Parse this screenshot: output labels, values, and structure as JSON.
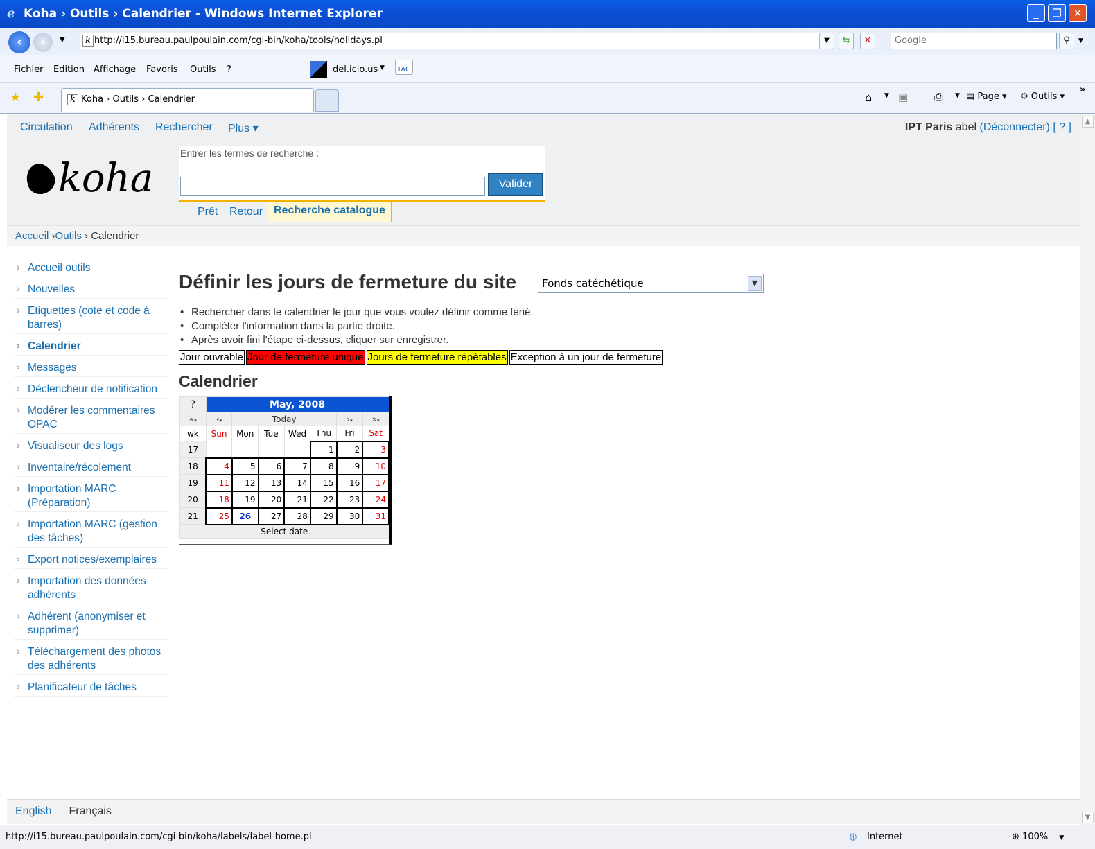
{
  "window": {
    "title": "Koha › Outils › Calendrier - Windows Internet Explorer",
    "ie_icon": "ie-logo",
    "controls": [
      "_",
      "❐",
      "✕"
    ]
  },
  "address": {
    "url": "http://i15.bureau.paulpoulain.com/cgi-bin/koha/tools/holidays.pl",
    "favicon": "k",
    "search_placeholder": "Google"
  },
  "menu": {
    "items": [
      "Fichier",
      "Edition",
      "Affichage",
      "Favoris",
      "Outils",
      "?"
    ],
    "delicious": "del.icio.us",
    "tag": "TAG"
  },
  "favbar": {
    "tab_title": "Koha › Outils › Calendrier",
    "page": "Page",
    "tools": "Outils"
  },
  "topnav": {
    "links": [
      "Circulation",
      "Adhérents",
      "Rechercher",
      "Plus ▾"
    ],
    "branch": "IPT Paris",
    "user": "abel",
    "logout": "(Déconnecter)",
    "help": "[ ? ]"
  },
  "logo": "koha",
  "search": {
    "label": "Entrer les termes de recherche :",
    "value": "",
    "button": "Valider",
    "tabs": [
      "Prêt",
      "Retour",
      "Recherche catalogue"
    ]
  },
  "breadcrumb": {
    "home": "Accueil",
    "sep1": " ›",
    "tools": "Outils",
    "sep2": " › ",
    "current": "Calendrier"
  },
  "sidebar": {
    "items": [
      "Accueil outils",
      "Nouvelles",
      "Etiquettes (cote et code à barres)",
      "Calendrier",
      "Messages",
      "Déclencheur de notification",
      "Modérer les commentaires OPAC",
      "Visualiseur des logs",
      "Inventaire/récolement",
      "Importation MARC (Préparation)",
      "Importation MARC (gestion des tâches)",
      "Export notices/exemplaires",
      "Importation des données adhérents",
      "Adhérent (anonymiser et supprimer)",
      "Téléchargement des photos des adhérents",
      "Planificateur de tâches"
    ],
    "current_index": 3
  },
  "main": {
    "title": "Définir les jours de fermeture du site",
    "branch_select": "Fonds catéchétique",
    "help": [
      "Rechercher dans le calendrier le jour que vous voulez définir comme férié.",
      "Compléter l'information dans la partie droite.",
      "Après avoir fini l'étape ci-dessus, cliquer sur enregistrer."
    ],
    "legend": [
      {
        "label": "Jour ouvrable",
        "color": "#ffffff"
      },
      {
        "label": "Jour de fermeture unique",
        "color": "#ff0000"
      },
      {
        "label": "Jours de fermeture répétables",
        "color": "#ffff00"
      },
      {
        "label": "Exception à un jour de fermeture",
        "color": "#ffffff"
      }
    ],
    "calendar_heading": "Calendrier"
  },
  "calendar": {
    "help": "?",
    "month": "May, 2008",
    "nav": [
      "«",
      "‹",
      "Today",
      "›",
      "»"
    ],
    "daynames": [
      "wk",
      "Sun",
      "Mon",
      "Tue",
      "Wed",
      "Thu",
      "Fri",
      "Sat"
    ],
    "weeks": [
      {
        "wk": "17",
        "days": [
          "",
          "",
          "",
          "",
          "1",
          "2",
          "3"
        ]
      },
      {
        "wk": "18",
        "days": [
          "4",
          "5",
          "6",
          "7",
          "8",
          "9",
          "10"
        ]
      },
      {
        "wk": "19",
        "days": [
          "11",
          "12",
          "13",
          "14",
          "15",
          "16",
          "17"
        ]
      },
      {
        "wk": "20",
        "days": [
          "18",
          "19",
          "20",
          "21",
          "22",
          "23",
          "24"
        ]
      },
      {
        "wk": "21",
        "days": [
          "25",
          "26",
          "27",
          "28",
          "29",
          "30",
          "31"
        ]
      }
    ],
    "today": "26",
    "footer": "Select date"
  },
  "footer": {
    "english": "English",
    "francais": "Français"
  },
  "status": {
    "url": "http://i15.bureau.paulpoulain.com/cgi-bin/koha/labels/label-home.pl",
    "zone": "Internet",
    "zoom": "100%"
  }
}
